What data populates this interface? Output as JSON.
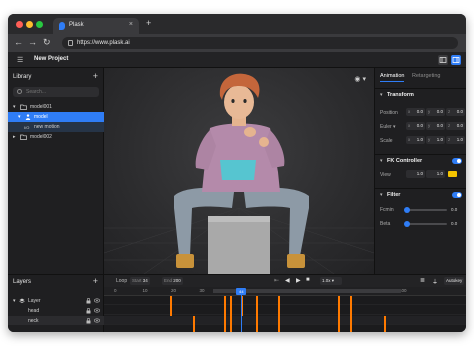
{
  "browser": {
    "tab_title": "Plask",
    "tab_close": "×",
    "new_tab": "+",
    "nav": {
      "back": "←",
      "forward": "→",
      "reload": "↻"
    },
    "url": "https://www.plask.ai"
  },
  "header": {
    "menu_icon": "☰",
    "project_title": "New Project",
    "toggle_left_icon": "sidebar-icon",
    "toggle_right_icon": "panel-icon"
  },
  "library": {
    "title": "Library",
    "add": "+",
    "search_placeholder": "Search...",
    "items": [
      {
        "label": "model001",
        "chevron": "▾",
        "icon": "folder-icon"
      },
      {
        "label": "model",
        "chevron": "▾",
        "icon": "person-icon"
      },
      {
        "label": "new motion",
        "icon": "motion-icon",
        "prefix": "I/O"
      },
      {
        "label": "model002",
        "chevron": "▸",
        "icon": "folder-icon"
      }
    ]
  },
  "viewport": {
    "eye_icon": "◉ ▾"
  },
  "inspector": {
    "tabs": [
      "Animation",
      "Retargeting"
    ],
    "transform": {
      "title": "Transform",
      "rows": [
        {
          "label": "Position",
          "x": "0.0",
          "y": "0.0",
          "z": "0.0"
        },
        {
          "label": "Euler ▾",
          "x": "0.0",
          "y": "0.0",
          "z": "0.0"
        },
        {
          "label": "Scale",
          "x": "1.0",
          "y": "1.0",
          "z": "1.0"
        }
      ]
    },
    "fk": {
      "title": "FK Controller",
      "row_label": "View",
      "a": "1.0",
      "b": "1.0",
      "color": "#f5c400"
    },
    "filter": {
      "title": "Filter",
      "rows": [
        {
          "label": "Fcmin",
          "value": "0.0",
          "level": 0.0
        },
        {
          "label": "Beta",
          "value": "0.0",
          "level": 0.0
        }
      ]
    }
  },
  "layers": {
    "title": "Layers",
    "add": "+",
    "rows": [
      {
        "label": "Layer",
        "chevron": "▾"
      },
      {
        "label": "head"
      },
      {
        "label": "neck"
      }
    ]
  },
  "timeline": {
    "loop_label": "Loop",
    "start_label": "Start",
    "start_value": "34",
    "end_label": "End",
    "end_value": "200",
    "speed": "1.0x",
    "autokey": "Autokey",
    "ticks": [
      "0",
      "10",
      "20",
      "30",
      "40",
      "50",
      "60",
      "70",
      "80",
      "90",
      "100"
    ],
    "current_frame": "44",
    "range_start": 34,
    "keyframes_top": [
      19,
      38,
      40,
      44,
      49,
      57,
      78,
      82
    ],
    "keyframes_bottom": [
      27,
      38,
      40,
      49,
      57,
      78,
      82,
      94
    ]
  },
  "colors": {
    "accent": "#2f7df6",
    "keyframe": "#ff7a00",
    "background": "#1b1b1d"
  }
}
